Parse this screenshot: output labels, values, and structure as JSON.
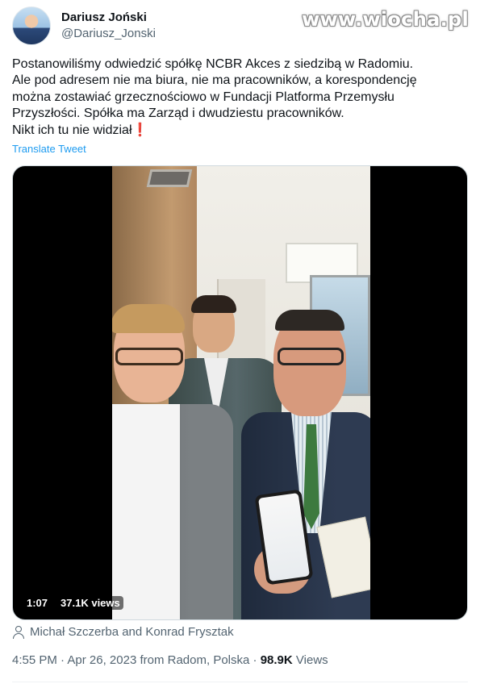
{
  "watermark": "www.wiocha.pl",
  "author": {
    "display_name": "Dariusz Joński",
    "handle": "@Dariusz_Jonski"
  },
  "tweet": {
    "text": "Postanowiliśmy odwiedzić spółkę NCBR Akces z siedzibą w Radomiu.\nAle pod adresem nie ma biura, nie ma pracowników, a korespondencję\nmożna zostawiać grzecznościowo w Fundacji Platforma Przemysłu\nPrzyszłości. Spółka ma Zarząd i dwudziestu pracowników.\nNikt ich tu nie widział",
    "emoji": "❗",
    "translate_label": "Translate Tweet"
  },
  "video": {
    "duration": "1:07",
    "views": "37.1K views"
  },
  "tagged_people": "Michał Szczerba and Konrad Frysztak",
  "meta": {
    "time": "4:55 PM",
    "separator": "·",
    "date": "Apr 26, 2023",
    "location": "from Radom, Polska",
    "views_count": "98.9K",
    "views_label": "Views"
  },
  "colors": {
    "link": "#1d9bf0",
    "secondary_text": "#536471",
    "primary_text": "#0f1419"
  }
}
